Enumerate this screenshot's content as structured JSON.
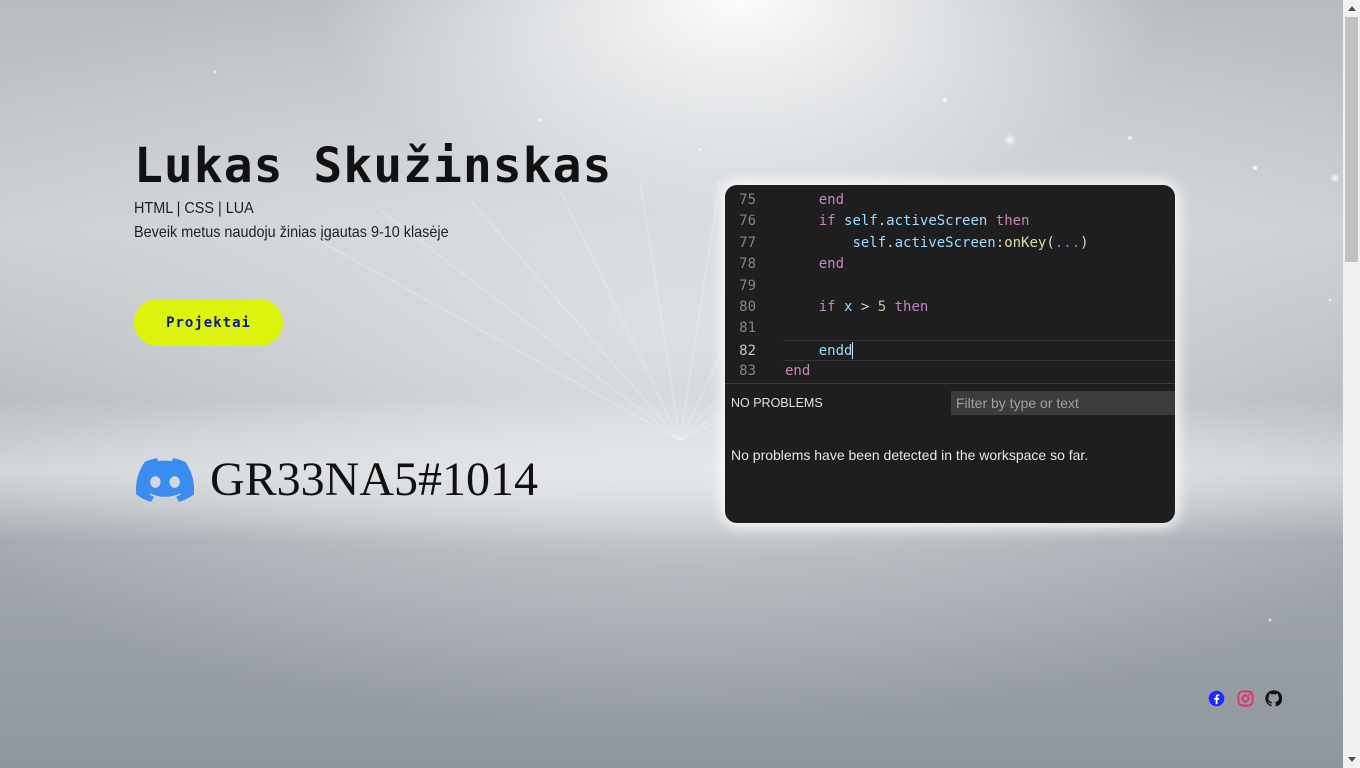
{
  "hero": {
    "name": "Lukas Skužinskas",
    "skills": "HTML | CSS | LUA",
    "tagline": "Beveik metus naudoju žinias įgautas 9-10 klasėje",
    "projects_button": "Projektai"
  },
  "discord": {
    "icon": "discord-icon",
    "tag": "GR33NA5#1014",
    "color": "#5865F2"
  },
  "editor": {
    "lines": [
      {
        "num": "75",
        "tokens": [
          {
            "t": "    "
          },
          {
            "t": "end",
            "c": "kw"
          }
        ]
      },
      {
        "num": "76",
        "tokens": [
          {
            "t": "    "
          },
          {
            "t": "if",
            "c": "kw"
          },
          {
            "t": " "
          },
          {
            "t": "self",
            "c": "var"
          },
          {
            "t": "."
          },
          {
            "t": "activeScreen",
            "c": "var"
          },
          {
            "t": " "
          },
          {
            "t": "then",
            "c": "kw"
          }
        ]
      },
      {
        "num": "77",
        "tokens": [
          {
            "t": "        "
          },
          {
            "t": "self",
            "c": "var"
          },
          {
            "t": "."
          },
          {
            "t": "activeScreen",
            "c": "var"
          },
          {
            "t": ":"
          },
          {
            "t": "onKey",
            "c": "fn"
          },
          {
            "t": "("
          },
          {
            "t": "...",
            "c": "dots"
          },
          {
            "t": ")"
          }
        ]
      },
      {
        "num": "78",
        "tokens": [
          {
            "t": "    "
          },
          {
            "t": "end",
            "c": "kw"
          }
        ]
      },
      {
        "num": "79",
        "tokens": []
      },
      {
        "num": "80",
        "tokens": [
          {
            "t": "    "
          },
          {
            "t": "if",
            "c": "kw"
          },
          {
            "t": " "
          },
          {
            "t": "x",
            "c": "var"
          },
          {
            "t": " > "
          },
          {
            "t": "5",
            "c": "num"
          },
          {
            "t": " "
          },
          {
            "t": "then",
            "c": "kw"
          }
        ]
      },
      {
        "num": "81",
        "tokens": []
      },
      {
        "num": "82",
        "tokens": [
          {
            "t": "    "
          },
          {
            "t": "endd",
            "c": "var"
          }
        ],
        "active": true
      },
      {
        "num": "83",
        "tokens": [
          {
            "t": "end",
            "c": "kw"
          }
        ]
      }
    ],
    "problems_header": "NO PROBLEMS",
    "filter_placeholder": "Filter by type or text",
    "problems_message": "No problems have been detected in the workspace so far."
  },
  "social": {
    "facebook": {
      "icon": "facebook-icon",
      "color": "#1b2bff"
    },
    "instagram": {
      "icon": "instagram-icon",
      "color": "#e1306c"
    },
    "github": {
      "icon": "github-icon",
      "color": "#111111"
    }
  },
  "colors": {
    "button_bg": "#dcf30c",
    "button_text": "#0a1a8c",
    "editor_bg": "#1e1e1e"
  }
}
